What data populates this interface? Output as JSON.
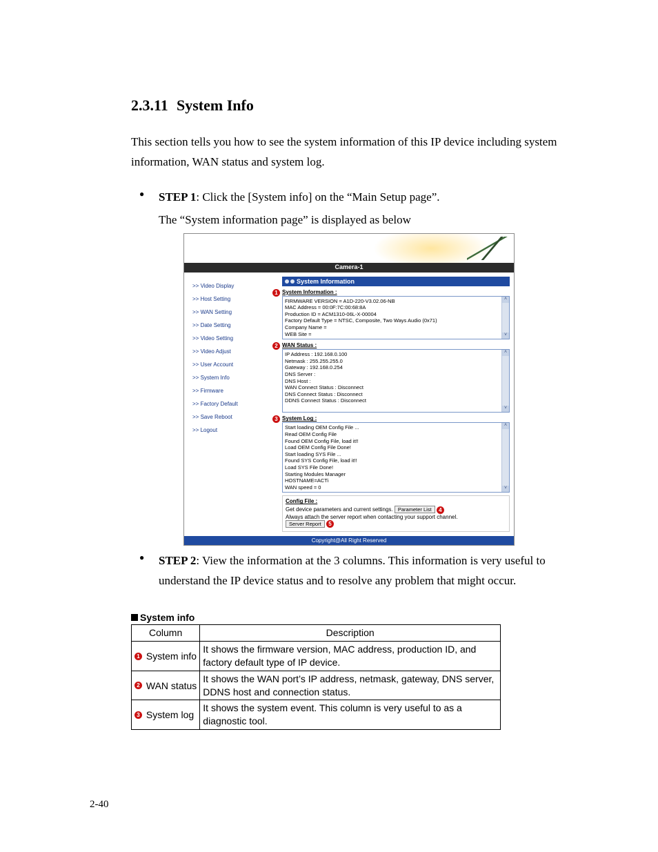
{
  "heading": {
    "number": "2.3.11",
    "title": "System Info"
  },
  "intro": "This section tells you how to see the system information of this IP device including system information, WAN status and system log.",
  "step1": {
    "label": "STEP 1",
    "text": ": Click the [System info] on the “Main Setup page”.",
    "caption": "The “System information page” is displayed as below"
  },
  "step2": {
    "label": "STEP 2",
    "text": ": View the information at the 3 columns. This information is very useful to understand the IP device status and to resolve any problem that might occur."
  },
  "shot": {
    "camera_title": "Camera-1",
    "nav": [
      ">>  Video Display",
      ">>  Host Setting",
      ">>  WAN Setting",
      ">>  Date Setting",
      ">>  Video Setting",
      ">>  Video Adjust",
      ">>  User Account",
      ">>  System Info",
      ">>  Firmware",
      ">>  Factory Default",
      ">>  Save Reboot",
      ">>  Logout"
    ],
    "panel_title": "System Information",
    "sec1": {
      "heading": "System Information :",
      "lines": [
        "FIRMWARE VERSION = A1D-220-V3.02.06-NB",
        "MAC Address = 00:0F:7C:00:68:8A",
        "Production ID = ACM1310-06L-X-00004",
        "Factory Default Type = NTSC, Composite, Two Ways Audio (0x71)",
        "Company Name =",
        "WEB Site ="
      ]
    },
    "sec2": {
      "heading": "WAN Status :",
      "lines": [
        "IP Address : 192.168.0.100",
        "Netmask : 255.255.255.0",
        "Gateway : 192.168.0.254",
        "DNS Server :",
        "DNS Host :",
        "WAN Connect Status : Disconnect",
        "DNS Connect Status : Disconnect",
        "DDNS Connect Status : Disconnect"
      ]
    },
    "sec3": {
      "heading": "System Log :",
      "lines": [
        "Start loading OEM Config File ...",
        "Read OEM Config File",
        "Found OEM Config File, load it!!",
        "Load OEM Config File Done!",
        "Start loading SYS File ...",
        "Found SYS Config File, load it!!",
        "Load SYS File Done!",
        "Starting Modules Manager",
        "HOSTNAME=ACTi",
        "WAN speed = 0"
      ]
    },
    "config": {
      "heading": "Config File :",
      "line": "Get device parameters and current settings.",
      "btn_param": "Parameter List",
      "line2": "Always attach the server report when contacting your support channel.",
      "btn_report": "Server Report"
    },
    "footer": "Copyright@All Right Reserved"
  },
  "table": {
    "heading": "System info",
    "headers": {
      "c1": "Column",
      "c2": "Description"
    },
    "rows": [
      {
        "n": "1",
        "name": "System info",
        "desc": "It shows the firmware version, MAC address, production ID, and factory default type of IP device."
      },
      {
        "n": "2",
        "name": "WAN status",
        "desc": "It shows the WAN port’s IP address, netmask, gateway, DNS server, DDNS host and connection status."
      },
      {
        "n": "3",
        "name": "System log",
        "desc": "It shows the system event. This column is very useful to as a diagnostic tool."
      }
    ]
  },
  "page_number": "2-40",
  "callouts": {
    "c1": "1",
    "c2": "2",
    "c3": "3",
    "c4": "4",
    "c5": "5"
  }
}
